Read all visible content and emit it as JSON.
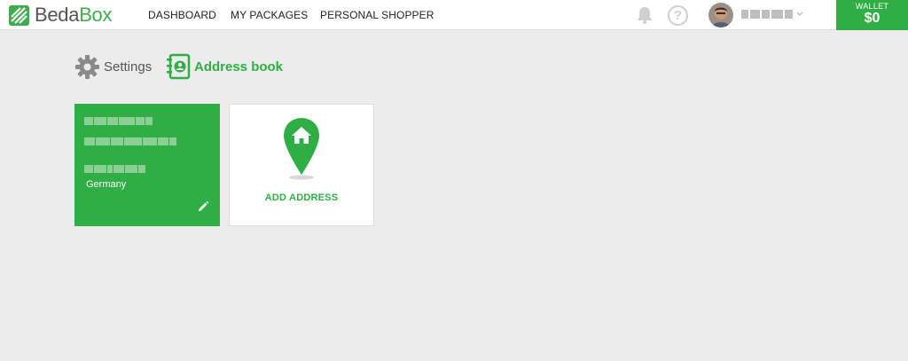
{
  "app": {
    "logo_text_1": "Beda",
    "logo_text_2": "Box",
    "brand_color": "#2fae45"
  },
  "nav": {
    "items": [
      "DASHBOARD",
      "MY PACKAGES",
      "PERSONAL SHOPPER"
    ]
  },
  "header": {
    "bell_icon": "bell-icon",
    "help_icon": "help-icon",
    "help_glyph": "?",
    "wallet_label": "WALLET",
    "wallet_amount": "$0"
  },
  "tabs": {
    "settings_label": "Settings",
    "address_label": "Address book"
  },
  "address_card": {
    "country": "Germany",
    "edit_icon": "pencil-icon"
  },
  "add_card": {
    "label": "ADD ADDRESS",
    "icon": "home-pin-icon"
  }
}
